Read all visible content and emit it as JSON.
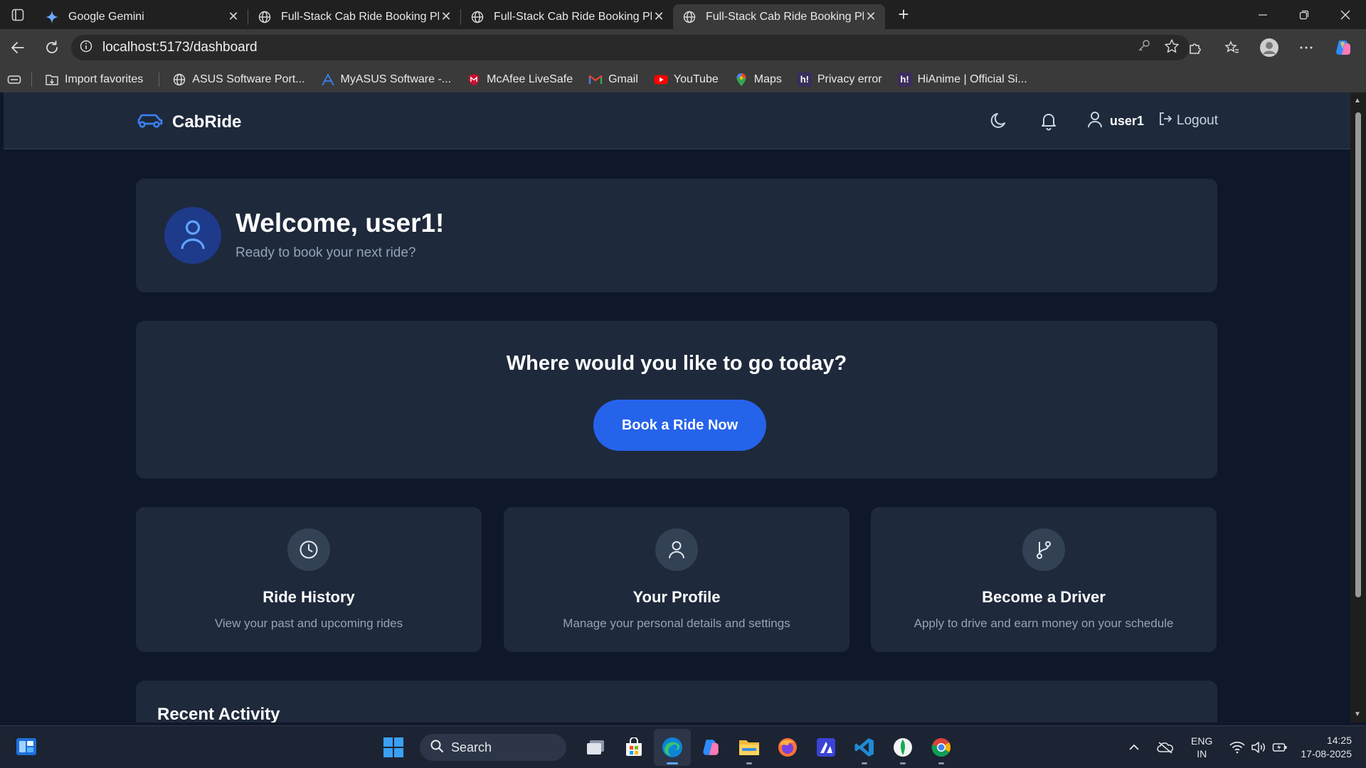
{
  "browser": {
    "tabs": [
      {
        "title": "Google Gemini",
        "active": false
      },
      {
        "title": "Full-Stack Cab Ride Booking Platfo",
        "active": false
      },
      {
        "title": "Full-Stack Cab Ride Booking Platfo",
        "active": false
      },
      {
        "title": "Full-Stack Cab Ride Booking Platfo",
        "active": true
      }
    ],
    "url": "localhost:5173/dashboard",
    "bookmarks": [
      "Import favorites",
      "ASUS Software Port...",
      "MyASUS Software -...",
      "McAfee LiveSafe",
      "Gmail",
      "YouTube",
      "Maps",
      "Privacy error",
      "HiAnime | Official Si..."
    ]
  },
  "app": {
    "brand": "CabRide",
    "username": "user1",
    "logout_label": "Logout",
    "welcome_title": "Welcome, user1!",
    "welcome_subtitle": "Ready to book your next ride?",
    "book_heading": "Where would you like to go today?",
    "book_button": "Book a Ride Now",
    "features": [
      {
        "title": "Ride History",
        "desc": "View your past and upcoming rides",
        "icon": "clock-icon"
      },
      {
        "title": "Your Profile",
        "desc": "Manage your personal details and settings",
        "icon": "user-icon"
      },
      {
        "title": "Become a Driver",
        "desc": "Apply to drive and earn money on your schedule",
        "icon": "git-branch-icon"
      }
    ],
    "recent_heading": "Recent Activity",
    "colors": {
      "primary": "#2563eb",
      "card": "#1e293b",
      "background": "#0f172a"
    }
  },
  "taskbar": {
    "search_label": "Search",
    "lang_line1": "ENG",
    "lang_line2": "IN",
    "time": "14:25",
    "date": "17-08-2025"
  }
}
